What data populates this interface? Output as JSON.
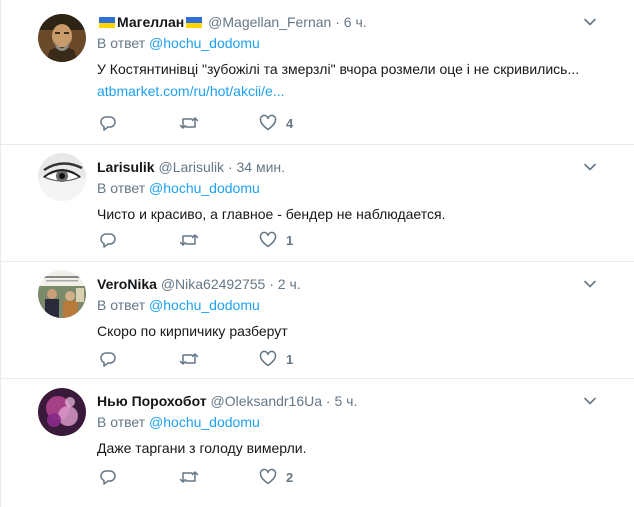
{
  "tweets": [
    {
      "name": "Магеллан",
      "handle": "@Magellan_Fernan",
      "time": "6 ч.",
      "reply_prefix": "В ответ",
      "reply_to": "@hochu_dodomu",
      "text": "У Костянтинівці \"зубожілі та змерзлі\" вчора розмели оце і не скривились...",
      "link": "atbmarket.com/ru/hot/akcii/e...",
      "likes": "4",
      "flags": true
    },
    {
      "name": "Larisulik",
      "handle": "@Larisulik",
      "time": "34 мин.",
      "reply_prefix": "В ответ",
      "reply_to": "@hochu_dodomu",
      "text": "Чисто и красиво, а главное - бендер не наблюдается.",
      "likes": "1"
    },
    {
      "name": "VeroNika",
      "handle": "@Nika62492755",
      "time": "2 ч.",
      "reply_prefix": "В ответ",
      "reply_to": "@hochu_dodomu",
      "text": "Скоро по кирпичику разберут",
      "likes": "1"
    },
    {
      "name": "Нью Порохобот",
      "handle": "@Oleksandr16Ua",
      "time": "5 ч.",
      "reply_prefix": "В ответ",
      "reply_to": "@hochu_dodomu",
      "text": "Даже таргани з голоду вимерли.",
      "likes": "2"
    }
  ],
  "colors": {
    "link": "#1da1f2",
    "muted": "#657786",
    "text": "#14171a",
    "border": "#e6ecf0"
  },
  "icons": [
    "reply-icon",
    "retweet-icon",
    "like-icon",
    "chevron-down-icon",
    "ukraine-flag-icon"
  ]
}
